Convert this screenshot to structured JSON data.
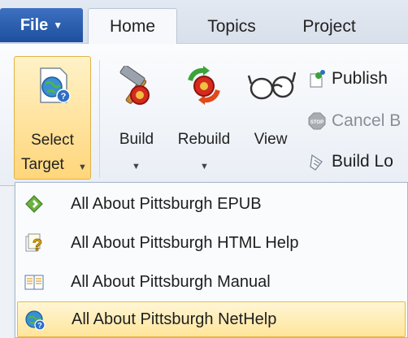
{
  "tabs": {
    "file_label": "File",
    "home_label": "Home",
    "topics_label": "Topics",
    "project_label": "Project"
  },
  "ribbon": {
    "select_target_line1": "Select",
    "select_target_line2": "Target",
    "build_label": "Build",
    "rebuild_label": "Rebuild",
    "view_label": "View",
    "publish_label": "Publish",
    "cancel_label": "Cancel B",
    "build_log_label": "Build Lo"
  },
  "menu": {
    "items": [
      {
        "label": "All About Pittsburgh EPUB",
        "icon": "epub-icon"
      },
      {
        "label": "All About Pittsburgh HTML Help",
        "icon": "html-help-icon"
      },
      {
        "label": "All About Pittsburgh Manual",
        "icon": "manual-icon"
      },
      {
        "label": "All About Pittsburgh NetHelp",
        "icon": "nethelp-icon"
      }
    ]
  },
  "colors": {
    "file_tab": "#2a5caf",
    "highlight": "#ffe59a",
    "highlight_border": "#e4b94e"
  }
}
